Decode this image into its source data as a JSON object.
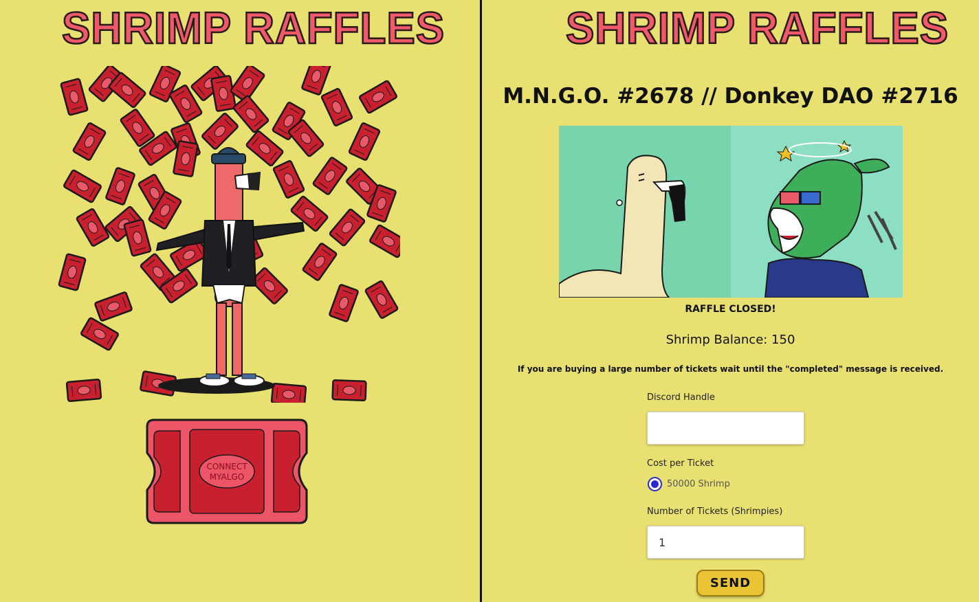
{
  "left": {
    "logo": "SHRIMP RAFFLES",
    "connect_button": {
      "line1": "CONNECT",
      "line2": "MYALGO"
    }
  },
  "right": {
    "logo": "SHRIMP RAFFLES",
    "raffle_title": "M.N.G.O. #2678 // Donkey DAO #2716",
    "status": "RAFFLE CLOSED!",
    "balance": "Shrimp Balance: 150",
    "notice": "If you are buying a large number of tickets wait until the \"completed\" message is received.",
    "form": {
      "discord_label": "Discord Handle",
      "discord_value": "",
      "cost_label": "Cost per Ticket",
      "cost_option": "50000 Shrimp",
      "tickets_label": "Number of Tickets (Shrimpies)",
      "tickets_value": "1",
      "send_label": "SEND"
    }
  },
  "colors": {
    "background": "#e8e070",
    "logo_pink": "#ee5a6a",
    "ticket_red": "#c8202f",
    "ticket_pink": "#ec5467",
    "radio_blue": "#2a2ad0",
    "send_yellow": "#e9c535"
  }
}
